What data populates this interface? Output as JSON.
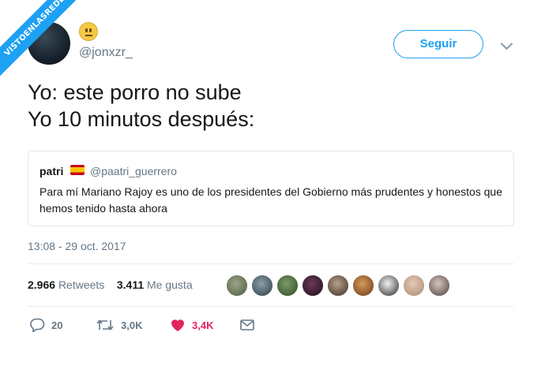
{
  "watermark": {
    "text": "VISTOENLASREDES"
  },
  "tweet": {
    "handle": "@jonxzr_",
    "follow_label": "Seguir",
    "text_line1": "Yo: este porro no sube",
    "text_line2": "Yo 10 minutos después:",
    "timestamp": "13:08 - 29 oct. 2017"
  },
  "quote": {
    "name": "patri",
    "handle": "@paatri_guerrero",
    "text": "Para mí Mariano Rajoy es uno de los presidentes del Gobierno más prudentes y honestos que hemos tenido hasta ahora"
  },
  "stats": {
    "retweets_count": "2.966",
    "retweets_label": "Retweets",
    "likes_count": "3.411",
    "likes_label": "Me gusta"
  },
  "actions": {
    "reply_count": "20",
    "retweet_count": "3,0K",
    "like_count": "3,4K"
  },
  "colors": {
    "accent": "#1da1f2",
    "like": "#e0245e",
    "muted": "#657786"
  },
  "icons": [
    "neutral-face-emoji",
    "chevron-down-icon",
    "spain-flag-icon",
    "reply-icon",
    "retweet-icon",
    "heart-icon",
    "mail-icon"
  ]
}
